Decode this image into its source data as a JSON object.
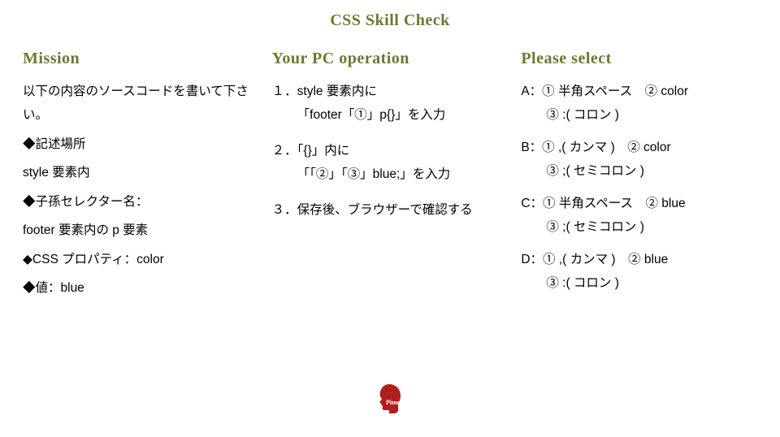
{
  "title": "CSS Skill Check",
  "mission": {
    "heading": "Mission",
    "intro": "以下の内容のソースコードを書いて下さい。",
    "loc_label": "◆記述場所",
    "loc_value": "style 要素内",
    "selector_label": "◆子孫セレクター名：",
    "selector_value": "footer 要素内の p 要素",
    "property": "◆CSS プロパティ：color",
    "value": "◆値：blue"
  },
  "operation": {
    "heading": "Your PC operation",
    "step1a": "１．style 要素内に",
    "step1b": "「footer「①」p{}」を入力",
    "step2a": "２．「{}」内に",
    "step2b": "「「②」「③」blue;」を入力",
    "step3": "３．保存後、ブラウザーで確認する"
  },
  "select": {
    "heading": "Please select",
    "A1": "A：① 半角スペース　② color",
    "A2": "③ :( コロン )",
    "B1": "B：① ,( カンマ )　② color",
    "B2": "③ ;( セミコロン )",
    "C1": "C：① 半角スペース　② blue",
    "C2": "③ ;( セミコロン )",
    "D1": "D：① ,( カンマ )　② blue",
    "D2": "③ :( コロン )"
  },
  "logo": {
    "text": "Pimc"
  }
}
